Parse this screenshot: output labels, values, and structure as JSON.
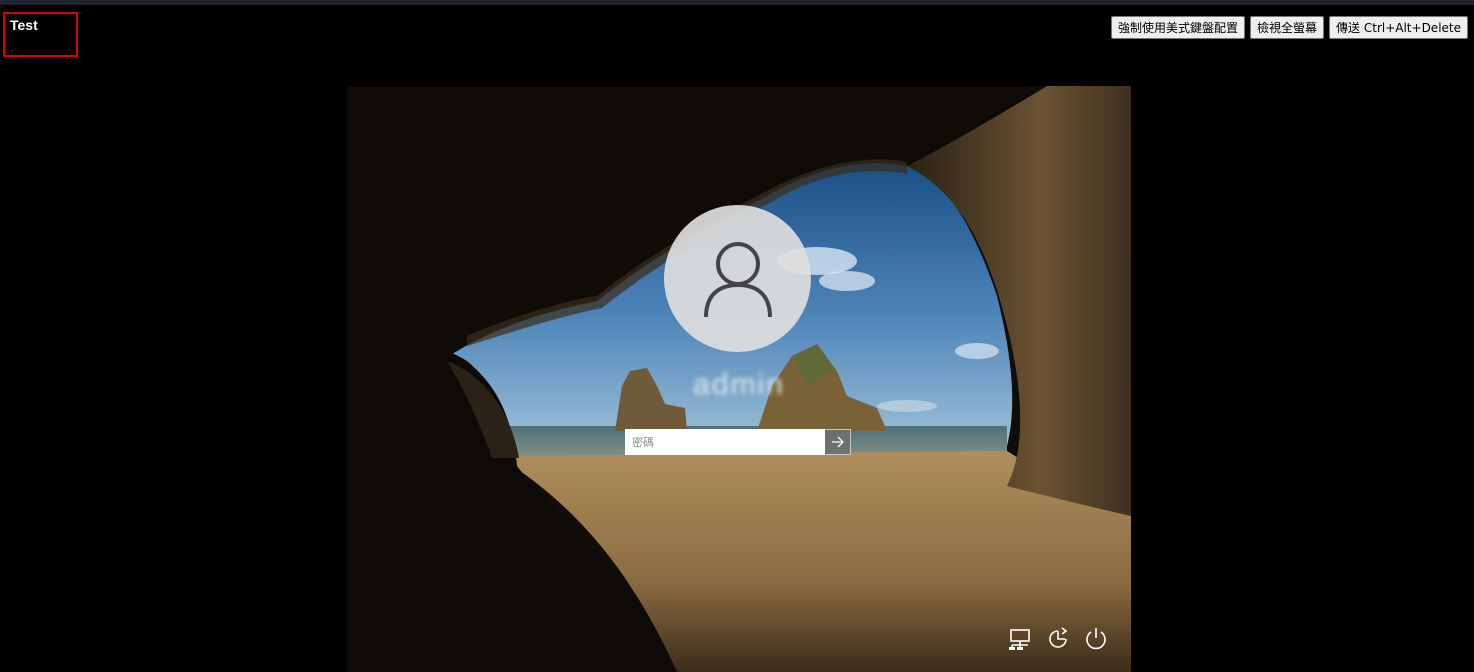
{
  "session": {
    "label": "Test",
    "frame_color": "#e00000"
  },
  "toolbar": {
    "force_us_keyboard_label": "強制使用美式鍵盤配置",
    "fullscreen_label": "檢視全螢幕",
    "send_cad_label": "傳送 Ctrl+Alt+Delete"
  },
  "lockscreen": {
    "username": "admin",
    "password_placeholder": "密碼",
    "submit_icon": "arrow-right-icon",
    "tray_icons": [
      "network-icon",
      "ease-of-access-icon",
      "power-icon"
    ]
  }
}
